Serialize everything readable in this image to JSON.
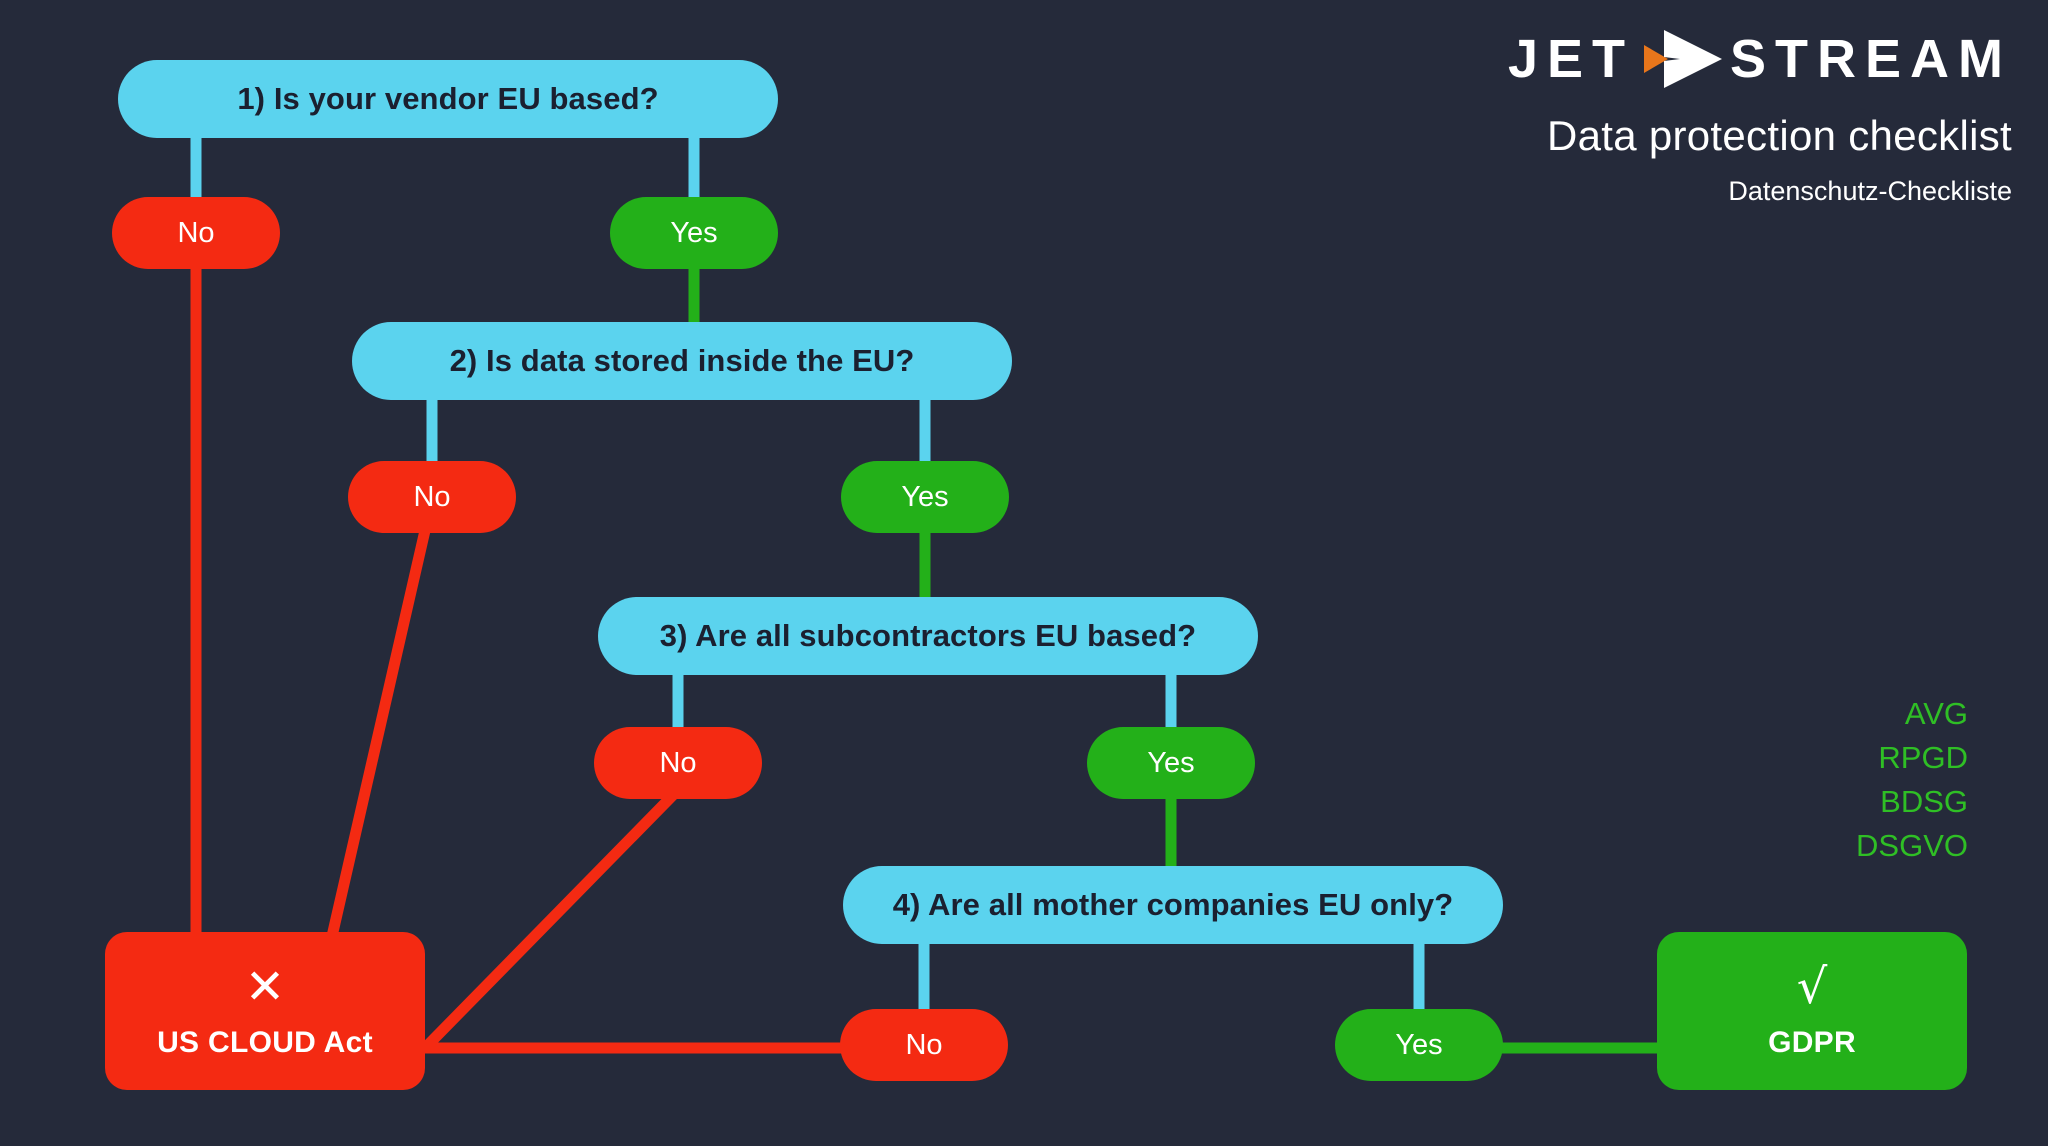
{
  "brand": {
    "logo_word_left": "JET",
    "logo_word_right": "STREAM",
    "logo_glyph": "paper-plane-arrow-icon",
    "headline": "Data protection checklist",
    "subheadline": "Datenschutz-Checkliste"
  },
  "colors": {
    "background": "#252a3a",
    "question": "#5BD3EE",
    "question_text": "#1b2030",
    "no": "#F42A12",
    "yes": "#23B019",
    "accent_orange": "#E8761B",
    "text_light": "#ffffff",
    "acronym_green": "#2FBF25"
  },
  "acronyms": [
    "AVG",
    "RPGD",
    "BDSG",
    "DSGVO"
  ],
  "chart_data": {
    "type": "diagram",
    "title": "Data protection checklist",
    "subtitle": "Datenschutz-Checkliste",
    "nodes": [
      {
        "id": "q1",
        "kind": "question",
        "label": "1) Is your vendor EU based?"
      },
      {
        "id": "q1_no",
        "kind": "answer-no",
        "label": "No"
      },
      {
        "id": "q1_yes",
        "kind": "answer-yes",
        "label": "Yes"
      },
      {
        "id": "q2",
        "kind": "question",
        "label": "2) Is data stored inside the EU?"
      },
      {
        "id": "q2_no",
        "kind": "answer-no",
        "label": "No"
      },
      {
        "id": "q2_yes",
        "kind": "answer-yes",
        "label": "Yes"
      },
      {
        "id": "q3",
        "kind": "question",
        "label": "3) Are all subcontractors EU based?"
      },
      {
        "id": "q3_no",
        "kind": "answer-no",
        "label": "No"
      },
      {
        "id": "q3_yes",
        "kind": "answer-yes",
        "label": "Yes"
      },
      {
        "id": "q4",
        "kind": "question",
        "label": "4) Are all mother companies EU only?"
      },
      {
        "id": "q4_no",
        "kind": "answer-no",
        "label": "No"
      },
      {
        "id": "q4_yes",
        "kind": "answer-yes",
        "label": "Yes"
      },
      {
        "id": "fail",
        "kind": "terminal-fail",
        "mark": "✕",
        "label": "US CLOUD Act"
      },
      {
        "id": "pass",
        "kind": "terminal-pass",
        "mark": "√",
        "label": "GDPR"
      }
    ],
    "edges": [
      {
        "from": "q1",
        "to": "q1_no",
        "color": "#5BD3EE"
      },
      {
        "from": "q1",
        "to": "q1_yes",
        "color": "#5BD3EE"
      },
      {
        "from": "q1_no",
        "to": "fail",
        "color": "#F42A12"
      },
      {
        "from": "q1_yes",
        "to": "q2",
        "color": "#23B019"
      },
      {
        "from": "q2",
        "to": "q2_no",
        "color": "#5BD3EE"
      },
      {
        "from": "q2",
        "to": "q2_yes",
        "color": "#5BD3EE"
      },
      {
        "from": "q2_no",
        "to": "fail",
        "color": "#F42A12"
      },
      {
        "from": "q2_yes",
        "to": "q3",
        "color": "#23B019"
      },
      {
        "from": "q3",
        "to": "q3_no",
        "color": "#5BD3EE"
      },
      {
        "from": "q3",
        "to": "q3_yes",
        "color": "#5BD3EE"
      },
      {
        "from": "q3_no",
        "to": "fail",
        "color": "#F42A12"
      },
      {
        "from": "q3_yes",
        "to": "q4",
        "color": "#23B019"
      },
      {
        "from": "q4",
        "to": "q4_no",
        "color": "#5BD3EE"
      },
      {
        "from": "q4",
        "to": "q4_yes",
        "color": "#5BD3EE"
      },
      {
        "from": "q4_no",
        "to": "fail",
        "color": "#F42A12"
      },
      {
        "from": "q4_yes",
        "to": "pass",
        "color": "#23B019"
      }
    ]
  },
  "flow": {
    "q1": {
      "label": "1) Is your vendor EU based?"
    },
    "q1_no": {
      "label": "No"
    },
    "q1_yes": {
      "label": "Yes"
    },
    "q2": {
      "label": "2) Is data stored inside the EU?"
    },
    "q2_no": {
      "label": "No"
    },
    "q2_yes": {
      "label": "Yes"
    },
    "q3": {
      "label": "3) Are all subcontractors EU based?"
    },
    "q3_no": {
      "label": "No"
    },
    "q3_yes": {
      "label": "Yes"
    },
    "q4": {
      "label": "4) Are all mother companies EU only?"
    },
    "q4_no": {
      "label": "No"
    },
    "q4_yes": {
      "label": "Yes"
    },
    "fail": {
      "mark": "✕",
      "label": "US CLOUD Act"
    },
    "pass": {
      "mark": "√",
      "label": "GDPR"
    }
  }
}
